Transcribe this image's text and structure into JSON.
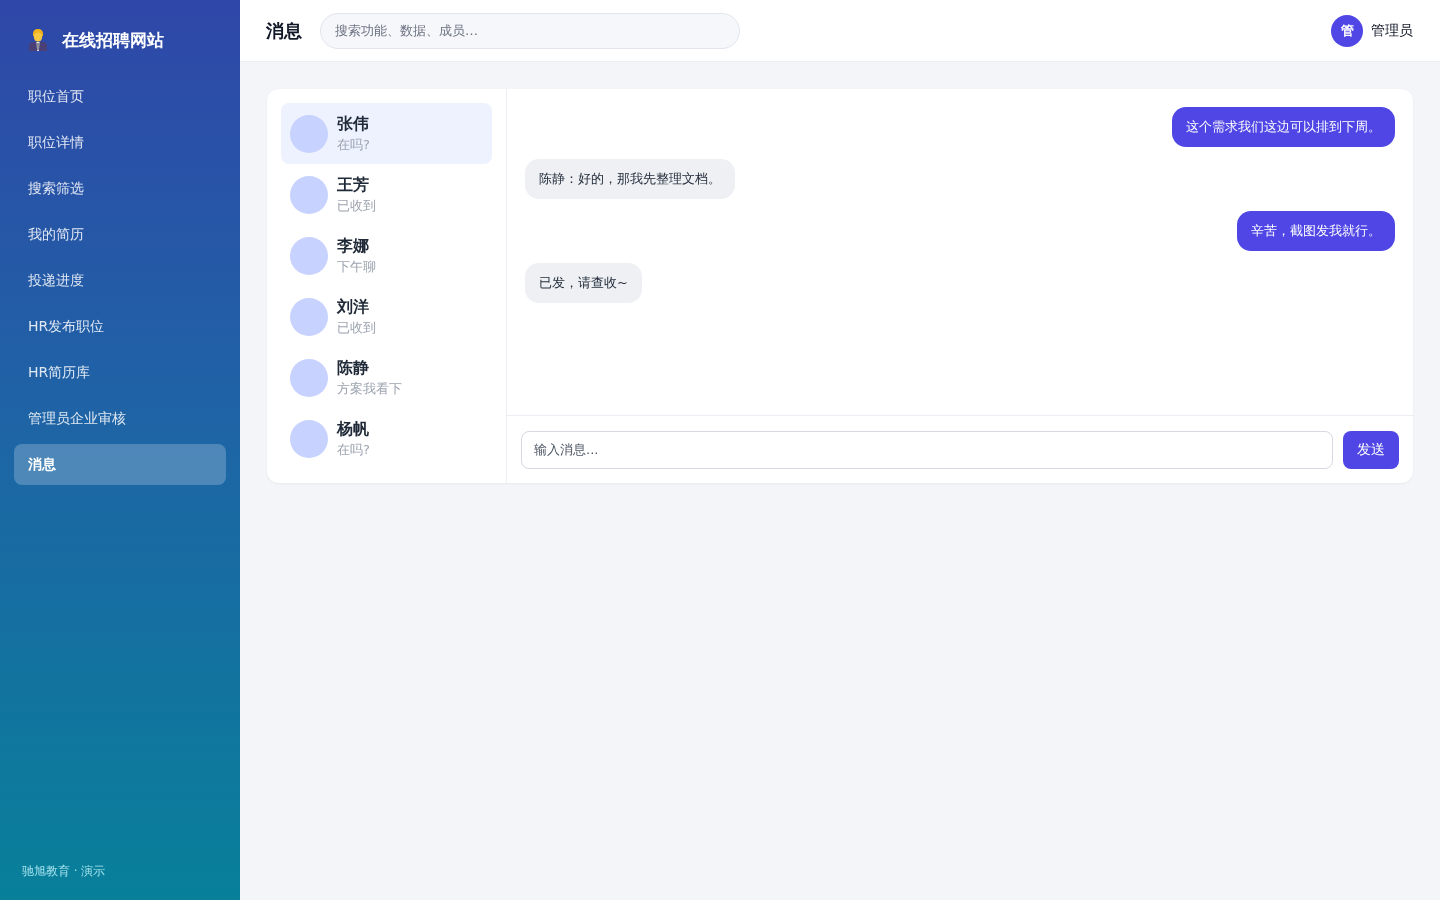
{
  "sidebar": {
    "logo": "在线招聘网站",
    "items": [
      {
        "label": "职位首页",
        "selected": false
      },
      {
        "label": "职位详情",
        "selected": false
      },
      {
        "label": "搜索筛选",
        "selected": false
      },
      {
        "label": "我的简历",
        "selected": false
      },
      {
        "label": "投递进度",
        "selected": false
      },
      {
        "label": "HR发布职位",
        "selected": false
      },
      {
        "label": "HR简历库",
        "selected": false
      },
      {
        "label": "管理员企业审核",
        "selected": false
      },
      {
        "label": "消息",
        "selected": true
      }
    ],
    "footer": "驰旭教育 · 演示"
  },
  "header": {
    "title": "消息",
    "search": {
      "placeholder": "搜索功能、数据、成员…"
    },
    "user": {
      "avatar": "管",
      "name": "管理员"
    }
  },
  "contacts": [
    {
      "name": "张伟",
      "preview": "在吗?",
      "selected": true
    },
    {
      "name": "王芳",
      "preview": "已收到",
      "selected": false
    },
    {
      "name": "李娜",
      "preview": "下午聊",
      "selected": false
    },
    {
      "name": "刘洋",
      "preview": "已收到",
      "selected": false
    },
    {
      "name": "陈静",
      "preview": "方案我看下",
      "selected": false
    },
    {
      "name": "杨帆",
      "preview": "在吗?",
      "selected": false
    }
  ],
  "messages": [
    {
      "kind": "sent",
      "text": "这个需求我们这边可以排到下周。"
    },
    {
      "kind": "received",
      "text": "陈静：好的，那我先整理文档。"
    },
    {
      "kind": "sent",
      "text": "辛苦，截图发我就行。"
    },
    {
      "kind": "received",
      "text": "已发，请查收~"
    }
  ],
  "composer": {
    "placeholder": "输入消息...",
    "send": "发送"
  }
}
